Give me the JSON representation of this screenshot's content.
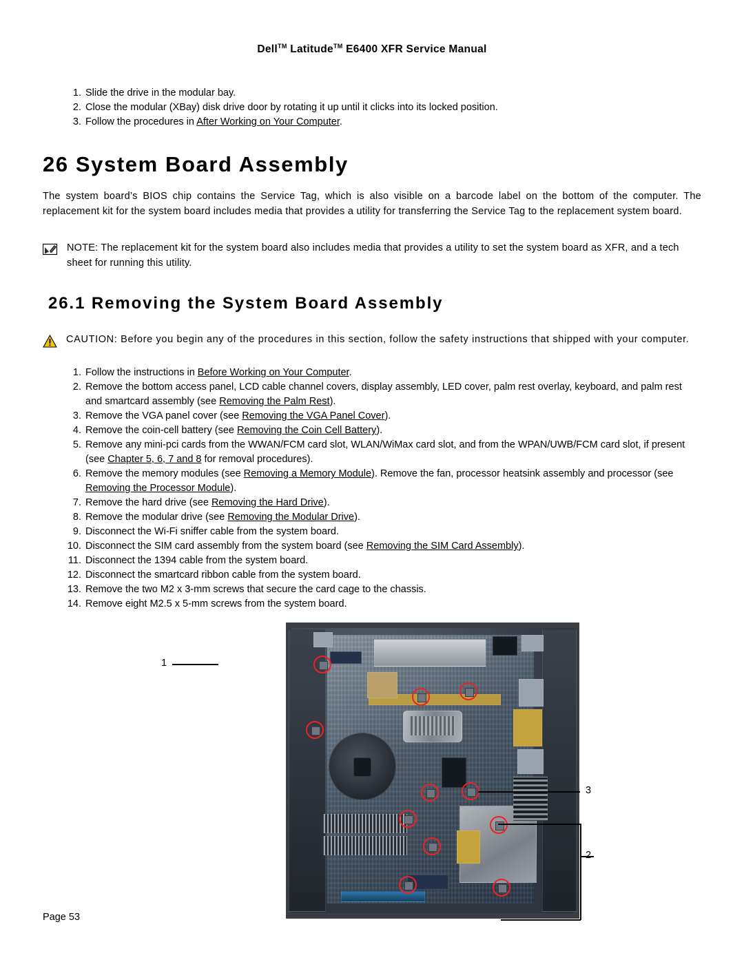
{
  "header": {
    "title_pre": "Dell",
    "tm1": "TM",
    "title_mid": " Latitude",
    "tm2": "TM",
    "title_post": " E6400 XFR Service Manual"
  },
  "top_steps": [
    {
      "num": "1.",
      "text": "Slide the drive in the modular bay."
    },
    {
      "num": "2.",
      "text": "Close the modular (XBay) disk drive door by rotating it up until it clicks into its locked position."
    },
    {
      "num": "3.",
      "text_pre": "Follow the procedures in ",
      "link": "After Working on Your Computer",
      "text_post": "."
    }
  ],
  "chapter": {
    "number": "26",
    "title": "System Board Assembly",
    "heading": "26  System Board Assembly"
  },
  "intro_paragraph": "The system board’s BIOS chip contains the Service Tag, which is also visible on a barcode label on the bottom of the computer. The replacement kit for the system board includes media that provides a utility for transferring the Service Tag to the replacement system board.",
  "note": {
    "icon": "note-pencil-icon",
    "label": "NOTE:",
    "text": " The replacement kit for the system board also includes media that provides a utility to set the system board as XFR, and a tech sheet for running this utility."
  },
  "section": {
    "number": "26.1",
    "title": "Removing the System Board Assembly",
    "heading": "26.1  Removing the System Board Assembly"
  },
  "caution": {
    "icon": "warning-triangle-icon",
    "label": "CAUTION:",
    "text": " Before you begin any of the procedures in this section, follow the safety instructions that shipped with your computer."
  },
  "procedure_steps": [
    {
      "num": "1.",
      "pre": "Follow the instructions in ",
      "link": "Before Working on Your Computer",
      "post": "."
    },
    {
      "num": "2.",
      "pre": "Remove the bottom access panel, LCD cable channel covers, display assembly, LED cover, palm rest overlay, keyboard, and palm rest and smartcard assembly (see ",
      "link": "Removing the Palm Rest",
      "post": ")."
    },
    {
      "num": "3.",
      "pre": "Remove the VGA panel cover (see ",
      "link": "Removing the VGA Panel Cover",
      "post": ")."
    },
    {
      "num": "4.",
      "pre": "Remove the coin-cell battery (see ",
      "link": "Removing the Coin Cell Battery",
      "post": ")."
    },
    {
      "num": "5.",
      "pre": "Remove any mini-pci cards from the WWAN/FCM card slot, WLAN/WiMax card slot, and from the WPAN/UWB/FCM card slot, if present (see ",
      "link": "Chapter 5, 6, 7 and 8",
      "post": " for removal procedures)."
    },
    {
      "num": "6.",
      "pre": "Remove the memory modules (see ",
      "link": "Removing a Memory Module",
      "post": ").\nRemove the fan, processor heatsink assembly and processor (see ",
      "link2": "Removing the Processor Module",
      "post2": ")."
    },
    {
      "num": "7.",
      "pre": "Remove the hard drive (see ",
      "link": "Removing the Hard Drive",
      "post": ")."
    },
    {
      "num": "8.",
      "pre": "Remove the modular drive (see ",
      "link": "Removing the Modular Drive",
      "post": ")."
    },
    {
      "num": "9.",
      "pre": "Disconnect the Wi-Fi sniffer cable from the system board.",
      "link": "",
      "post": ""
    },
    {
      "num": "10.",
      "pre": "Disconnect the SIM card assembly from the system board (see ",
      "link": "Removing the SIM Card Assembly",
      "post": ")."
    },
    {
      "num": "11.",
      "pre": "Disconnect the 1394 cable from the system board.",
      "link": "",
      "post": ""
    },
    {
      "num": "12.",
      "pre": "Disconnect the smartcard ribbon cable from the system board.",
      "link": "",
      "post": ""
    },
    {
      "num": "13.",
      "pre": "Remove the two M2 x 3-mm screws that secure the card cage to the chassis.",
      "link": "",
      "post": ""
    },
    {
      "num": "14.",
      "pre": "Remove eight M2.5 x 5-mm screws from the system board.",
      "link": "",
      "post": ""
    }
  ],
  "figure": {
    "name": "system-board-screw-locations-photo",
    "callouts": [
      "1",
      "3",
      "2"
    ]
  },
  "footer": {
    "page_label": "Page 53"
  },
  "colors": {
    "screw_highlight": "#ee2222",
    "text": "#000000",
    "background": "#ffffff"
  }
}
